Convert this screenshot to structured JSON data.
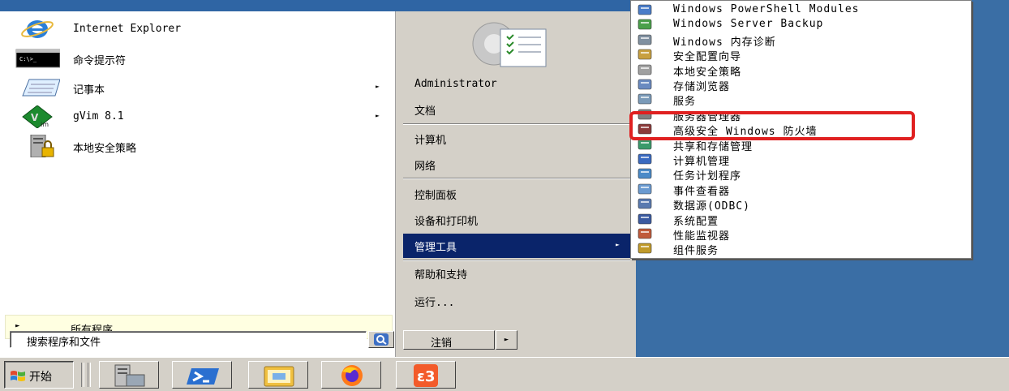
{
  "start_menu": {
    "pinned": [
      {
        "label": "Internet Explorer",
        "icon": "internet-explorer-icon",
        "has_arrow": false
      },
      {
        "label": "命令提示符",
        "icon": "command-prompt-icon",
        "has_arrow": false
      },
      {
        "label": "记事本",
        "icon": "notepad-icon",
        "has_arrow": true
      },
      {
        "label": "gVim 8.1",
        "icon": "gvim-icon",
        "has_arrow": true
      },
      {
        "label": "本地安全策略",
        "icon": "local-security-policy-icon",
        "has_arrow": false
      }
    ],
    "all_programs": "所有程序",
    "search_placeholder": "搜索程序和文件",
    "right_items": [
      {
        "label": "Administrator"
      },
      {
        "label": "文档"
      },
      {
        "label": "计算机"
      },
      {
        "label": "网络"
      },
      {
        "label": "控制面板"
      },
      {
        "label": "设备和打印机"
      },
      {
        "label": "管理工具",
        "selected": true,
        "has_arrow": true
      },
      {
        "label": "帮助和支持"
      },
      {
        "label": "运行..."
      }
    ],
    "logoff_label": "注销"
  },
  "admin_tools_submenu": {
    "items": [
      {
        "label": "Windows PowerShell Modules",
        "icon": "powershell-modules-icon"
      },
      {
        "label": "Windows Server Backup",
        "icon": "server-backup-icon"
      },
      {
        "label": "Windows 内存诊断",
        "icon": "memory-diagnostic-icon"
      },
      {
        "label": "安全配置向导",
        "icon": "security-wizard-icon"
      },
      {
        "label": "本地安全策略",
        "icon": "local-security-policy-icon"
      },
      {
        "label": "存储浏览器",
        "icon": "storage-explorer-icon"
      },
      {
        "label": "服务",
        "icon": "services-icon"
      },
      {
        "label": "服务器管理器",
        "icon": "server-manager-icon"
      },
      {
        "label": "高级安全 Windows 防火墙",
        "icon": "firewall-icon",
        "highlighted": true
      },
      {
        "label": "共享和存储管理",
        "icon": "share-storage-icon"
      },
      {
        "label": "计算机管理",
        "icon": "computer-management-icon"
      },
      {
        "label": "任务计划程序",
        "icon": "task-scheduler-icon"
      },
      {
        "label": "事件查看器",
        "icon": "event-viewer-icon"
      },
      {
        "label": "数据源(ODBC)",
        "icon": "odbc-icon"
      },
      {
        "label": "系统配置",
        "icon": "system-config-icon"
      },
      {
        "label": "性能监视器",
        "icon": "performance-monitor-icon"
      },
      {
        "label": "组件服务",
        "icon": "component-services-icon"
      }
    ],
    "highlight_color": "#e02020"
  },
  "taskbar": {
    "start_label": "开始",
    "apps": [
      {
        "icon": "server-manager-icon"
      },
      {
        "icon": "powershell-icon"
      },
      {
        "icon": "file-explorer-icon"
      },
      {
        "icon": "firefox-icon"
      },
      {
        "icon": "xampp-icon"
      }
    ]
  },
  "colors": {
    "desktop": "#3a6ea5",
    "selection": "#0a246a",
    "menu_face": "#d4d0c8"
  }
}
